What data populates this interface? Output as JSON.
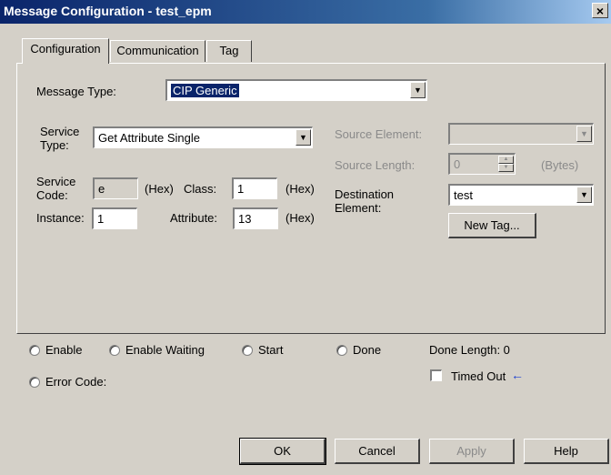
{
  "window": {
    "title": "Message Configuration - test_epm",
    "close_glyph": "×"
  },
  "tabs": [
    "Configuration",
    "Communication",
    "Tag"
  ],
  "config": {
    "message_type_label": "Message Type:",
    "message_type_value": "CIP Generic",
    "service_type_label": "Service\nType:",
    "service_type_value": "Get Attribute Single",
    "service_code_label": "Service\nCode:",
    "service_code_value": "e",
    "hex_label": "(Hex)",
    "class_label": "Class:",
    "class_value": "1",
    "instance_label": "Instance:",
    "instance_value": "1",
    "attribute_label": "Attribute:",
    "attribute_value": "13",
    "source_element_label": "Source Element:",
    "source_element_value": "",
    "source_length_label": "Source Length:",
    "source_length_value": "0",
    "bytes_label": "(Bytes)",
    "destination_label": "Destination\nElement:",
    "destination_value": "test",
    "new_tag_label": "New Tag..."
  },
  "status": {
    "enable": "Enable",
    "enable_waiting": "Enable Waiting",
    "start": "Start",
    "done": "Done",
    "done_length": "Done Length: 0",
    "error_code": "Error Code:",
    "timed_out": "Timed Out"
  },
  "buttons": {
    "ok": "OK",
    "cancel": "Cancel",
    "apply": "Apply",
    "help": "Help"
  },
  "icons": {
    "dropdown": "dropdown-arrow-icon",
    "timed_out_pointer": "left-arrow-icon"
  },
  "colors": {
    "title_bar": "#0a246a",
    "face": "#d4d0c8",
    "selection": "#0a246a",
    "arrow": "#1a3fd0"
  }
}
